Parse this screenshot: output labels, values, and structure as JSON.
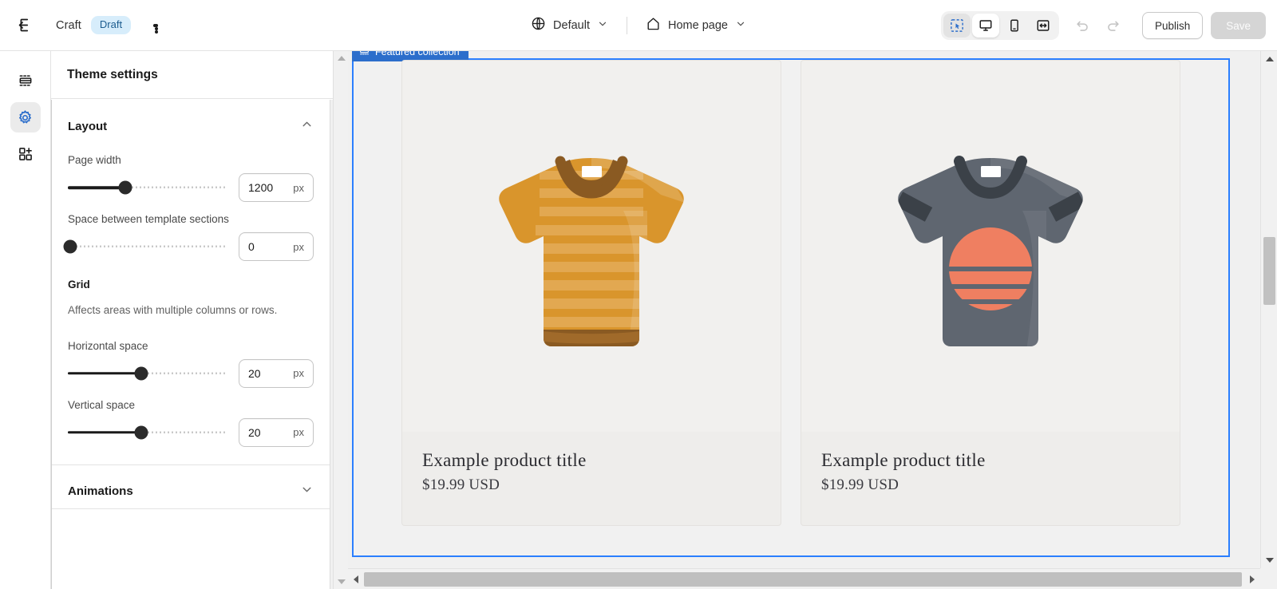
{
  "topbar": {
    "exit_icon": "exit-icon",
    "theme_name": "Craft",
    "status_badge": "Draft",
    "more_menu": "more-menu-icon",
    "locale_selector": {
      "icon": "globe-icon",
      "label": "Default",
      "chevron": "chevron-down-icon"
    },
    "page_selector": {
      "icon": "home-icon",
      "label": "Home page",
      "chevron": "chevron-down-icon"
    },
    "devices": [
      {
        "name": "select-tool",
        "icon": "cursor-select-icon",
        "active": true
      },
      {
        "name": "desktop",
        "icon": "desktop-icon",
        "active": true
      },
      {
        "name": "mobile",
        "icon": "mobile-icon",
        "active": false
      },
      {
        "name": "fullscreen",
        "icon": "fullscreen-icon",
        "active": false
      }
    ],
    "undo_icon": "undo-icon",
    "redo_icon": "redo-icon",
    "publish_label": "Publish",
    "save_label": "Save"
  },
  "rail": {
    "items": [
      {
        "name": "sections",
        "icon": "sections-icon",
        "active": false
      },
      {
        "name": "theme-settings",
        "icon": "gear-icon",
        "active": true
      },
      {
        "name": "apps",
        "icon": "app-blocks-icon",
        "active": false
      }
    ]
  },
  "panel": {
    "title": "Theme settings",
    "sections": [
      {
        "name": "layout",
        "title": "Layout",
        "expanded": true,
        "chevron": "chevron-up-icon",
        "fields": [
          {
            "name": "page-width",
            "label": "Page width",
            "value": "1200",
            "unit": "px",
            "fill_pct": 36
          },
          {
            "name": "space-between-template-sections",
            "label": "Space between template sections",
            "value": "0",
            "unit": "px",
            "fill_pct": 0
          }
        ],
        "grid": {
          "heading": "Grid",
          "help": "Affects areas with multiple columns or rows.",
          "fields": [
            {
              "name": "horizontal-space",
              "label": "Horizontal space",
              "value": "20",
              "unit": "px",
              "fill_pct": 46
            },
            {
              "name": "vertical-space",
              "label": "Vertical space",
              "value": "20",
              "unit": "px",
              "fill_pct": 46
            }
          ]
        }
      },
      {
        "name": "animations",
        "title": "Animations",
        "expanded": false,
        "chevron": "chevron-down-icon"
      }
    ]
  },
  "preview": {
    "section_badge": {
      "icon": "section-icon",
      "label": "Featured collection"
    },
    "products": [
      {
        "name": "product-card-1",
        "title": "Example product title",
        "price": "$19.99 USD",
        "image": "orange-striped-tshirt"
      },
      {
        "name": "product-card-2",
        "title": "Example product title",
        "price": "$19.99 USD",
        "image": "gray-sunset-tshirt"
      }
    ]
  },
  "colors": {
    "accent": "#2c6ecb",
    "selection_border": "#2b7fff",
    "draft_badge_bg": "#d7edfb",
    "draft_badge_text": "#1c5c8f",
    "shirt1_main": "#d9952c",
    "shirt1_stripe": "#e0a84f",
    "shirt1_trim": "#8a5a22",
    "shirt2_main": "#5f6670",
    "shirt2_trim": "#3b4148",
    "shirt2_graphic": "#ef7f61"
  }
}
